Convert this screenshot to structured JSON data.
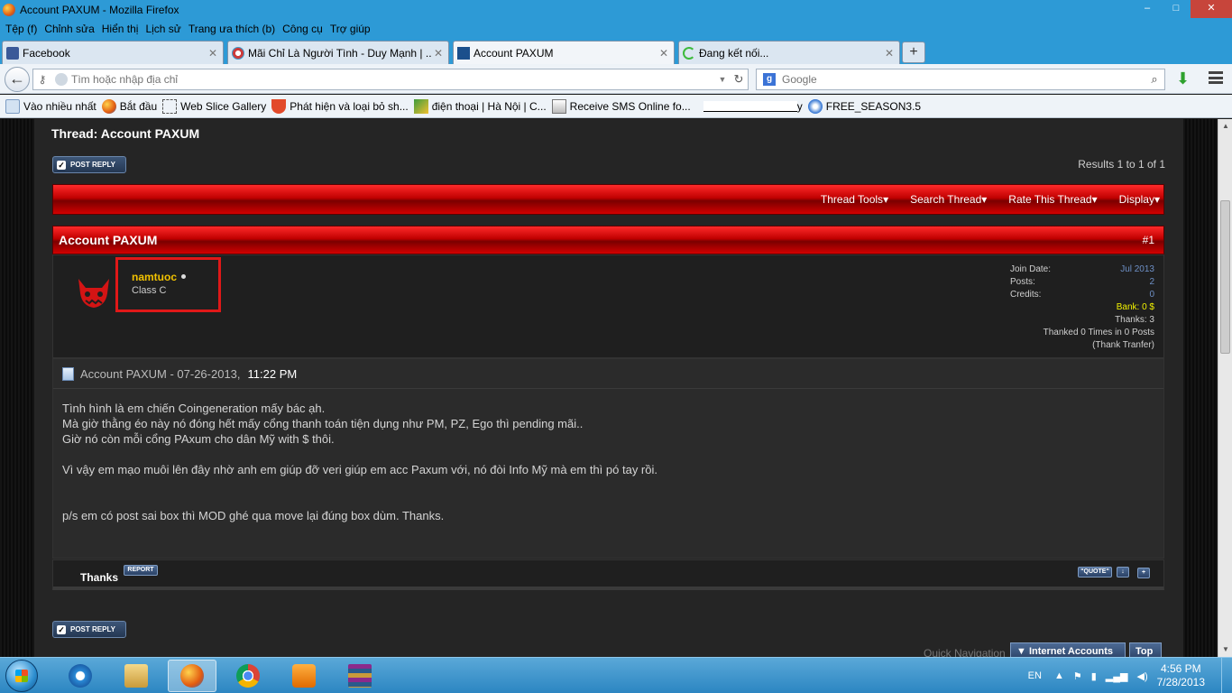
{
  "window": {
    "title": "Account PAXUM - Mozilla Firefox",
    "minimize": "–",
    "maximize": "□",
    "close": "✕"
  },
  "menu": [
    "Tệp (f)",
    "Chỉnh sửa",
    "Hiển thị",
    "Lịch sử",
    "Trang ưa thích (b)",
    "Công cụ",
    "Trợ giúp"
  ],
  "tabs": [
    {
      "label": "Facebook",
      "icon": "facebook-icon",
      "close": "✕"
    },
    {
      "label": "Mãi Chỉ Là Người Tình - Duy Mạnh | ...",
      "icon": "music-icon",
      "close": "✕"
    },
    {
      "label": "Account PAXUM",
      "icon": "forum-icon",
      "close": "✕"
    },
    {
      "label": "Đang kết nối...",
      "icon": "loading-icon",
      "close": "✕"
    }
  ],
  "newtab_label": "+",
  "nav": {
    "url_placeholder": "Tìm hoặc nhập địa chỉ",
    "search_placeholder": "Google",
    "back": "←",
    "reload": "↻",
    "drop": "▼",
    "search_engine": "g"
  },
  "bookmarks": [
    {
      "label": "Vào nhiều nhất",
      "icon": "most-visited-icon"
    },
    {
      "label": "Bắt đầu",
      "icon": "firefox-icon"
    },
    {
      "label": "Web Slice Gallery",
      "icon": "web-slice-icon"
    },
    {
      "label": "Phát hiện và loại bỏ sh...",
      "icon": "shield-icon"
    },
    {
      "label": "điện thoại | Hà Nội | C...",
      "icon": "site-icon"
    },
    {
      "label": "Receive SMS Online fo...",
      "icon": "sms-icon"
    },
    {
      "label": "y",
      "icon": "redacted"
    },
    {
      "label": "FREE_SEASON3.5",
      "icon": "game-icon"
    }
  ],
  "thread": {
    "title": "Thread: Account PAXUM",
    "post_reply": "POST REPLY",
    "results": "Results 1 to 1 of 1",
    "tools": [
      "Thread Tools",
      "Search Thread",
      "Rate This Thread",
      "Display"
    ],
    "post": {
      "title": "Account PAXUM",
      "number": "#1",
      "username": "namtuoc",
      "usertitle": "Class C",
      "stats": {
        "join_label": "Join Date:",
        "join_value": "Jul 2013",
        "posts_label": "Posts:",
        "posts_value": "2",
        "credits_label": "Credits:",
        "credits_value": "0",
        "bank": "Bank: 0 $",
        "thanks": "Thanks: 3",
        "thanked": "Thanked 0 Times in 0 Posts",
        "thank_tranfer": "(Thank Tranfer)"
      },
      "meta": "Account PAXUM - 07-26-2013,",
      "time": "11:22 PM",
      "lines": [
        "Tình hình là em chiến Coingeneration mấy bác ạh.",
        "Mà giờ thằng éo này nó đóng hết mấy cổng thanh toán tiện dụng như PM, PZ, Ego thì pending mãi..",
        "Giờ nó còn mỗi cổng PAxum cho dân Mỹ with $ thôi.",
        "Vì vậy em mạo muôi lên đây nhờ anh em giúp đỡ veri giúp em acc Paxum với, nó đòi Info Mỹ mà em thì pó tay rồi.",
        "p/s em có post sai box thì MOD ghé qua move lại đúng box dùm. Thanks."
      ],
      "thanks_label": "Thanks",
      "report": "REPORT",
      "quote": "\"QUOTE\"",
      "multiquote": "+",
      "quick_reply": "↓"
    },
    "quick_navigation": "Quick Navigation",
    "forum_dropdown": "▼ Internet Accounts",
    "top": "Top"
  },
  "scroll": {
    "up": "▲",
    "down": "▼"
  },
  "taskbar": {
    "lang": "EN",
    "time": "4:56 PM",
    "date": "7/28/2013",
    "apps": [
      "internet-explorer-icon",
      "file-explorer-icon",
      "firefox-icon",
      "chrome-icon",
      "media-player-icon",
      "winrar-icon"
    ],
    "tray_arrow": "▲",
    "flag": "⚑",
    "battery": "▮",
    "signal": "▂▄▆",
    "volume": "◀)"
  }
}
